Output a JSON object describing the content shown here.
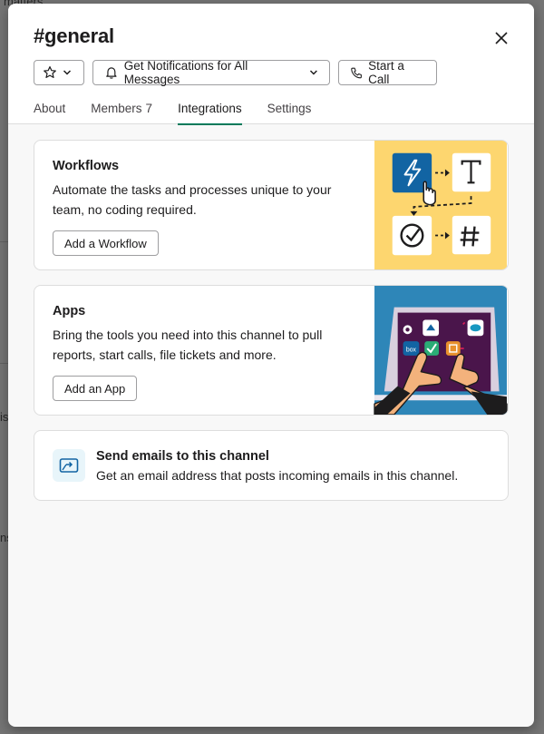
{
  "channel": {
    "hash": "#",
    "name": "general"
  },
  "header": {
    "star_icon": "star-icon",
    "notifications_label": "Get Notifications for All Messages",
    "call_label": "Start a Call"
  },
  "tabs": [
    {
      "label": "About",
      "active": false
    },
    {
      "label": "Members",
      "count": "7",
      "active": false
    },
    {
      "label": "Integrations",
      "active": true
    },
    {
      "label": "Settings",
      "active": false
    }
  ],
  "workflows": {
    "title": "Workflows",
    "description": "Automate the tasks and processes unique to your team, no coding required.",
    "button": "Add a Workflow"
  },
  "apps": {
    "title": "Apps",
    "description": "Bring the tools you need into this channel to pull reports, start calls, file tickets and more.",
    "button": "Add an App",
    "tiles": {
      "box": "box"
    }
  },
  "email": {
    "title": "Send emails to this channel",
    "description": "Get an email address that posts incoming emails in this channel."
  },
  "background": {
    "fragments": [
      "matters",
      "is",
      "ns"
    ]
  },
  "colors": {
    "accent": "#007a5a",
    "workflow_bg": "#fdd66f",
    "workflow_blue": "#1264a3",
    "apps_bg": "#2e86b8",
    "laptop": "#4a154b"
  }
}
